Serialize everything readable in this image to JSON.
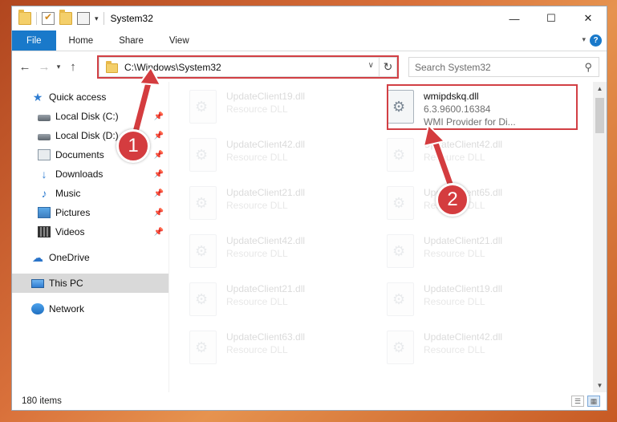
{
  "titlebar": {
    "title": "System32",
    "minimize": "—",
    "maximize": "☐",
    "close": "✕"
  },
  "ribbon": {
    "tabs": [
      "File",
      "Home",
      "Share",
      "View"
    ],
    "help": "?"
  },
  "address": {
    "path": "C:\\Windows\\System32",
    "search_placeholder": "Search System32"
  },
  "nav": {
    "items": [
      {
        "label": "Quick access",
        "icon": "star-icon",
        "pinned": false
      },
      {
        "label": "Local Disk (C:)",
        "icon": "disk-icon",
        "pinned": true
      },
      {
        "label": "Local Disk (D:)",
        "icon": "disk-icon",
        "pinned": true
      },
      {
        "label": "Documents",
        "icon": "documents-icon",
        "pinned": true
      },
      {
        "label": "Downloads",
        "icon": "download-icon",
        "pinned": true
      },
      {
        "label": "Music",
        "icon": "music-icon",
        "pinned": true
      },
      {
        "label": "Pictures",
        "icon": "pictures-icon",
        "pinned": true
      },
      {
        "label": "Videos",
        "icon": "videos-icon",
        "pinned": true
      },
      {
        "label": "OneDrive",
        "icon": "onedrive-icon"
      },
      {
        "label": "This PC",
        "icon": "computer-icon",
        "selected": true
      },
      {
        "label": "Network",
        "icon": "network-icon"
      }
    ]
  },
  "files": [
    {
      "name": "UpdateClient19.dll",
      "type": "Resource DLL",
      "faded": true
    },
    {
      "name": "wmipdskq.dll",
      "type": "6.3.9600.16384",
      "extra": "WMI Provider for Di...",
      "faded": false
    },
    {
      "name": "UpdateClient42.dll",
      "type": "Resource DLL",
      "faded": true
    },
    {
      "name": "UpdateClient42.dll",
      "type": "Resource DLL",
      "faded": true
    },
    {
      "name": "UpdateClient21.dll",
      "type": "Resource DLL",
      "faded": true
    },
    {
      "name": "UpdateClient65.dll",
      "type": "Resource DLL",
      "faded": true
    },
    {
      "name": "UpdateClient42.dll",
      "type": "Resource DLL",
      "faded": true
    },
    {
      "name": "UpdateClient21.dll",
      "type": "Resource DLL",
      "faded": true
    },
    {
      "name": "UpdateClient21.dll",
      "type": "Resource DLL",
      "faded": true
    },
    {
      "name": "UpdateClient19.dll",
      "type": "Resource DLL",
      "faded": true
    },
    {
      "name": "UpdateClient63.dll",
      "type": "Resource DLL",
      "faded": true
    },
    {
      "name": "UpdateClient42.dll",
      "type": "Resource DLL",
      "faded": true
    }
  ],
  "status": {
    "count": "180 items"
  },
  "annotations": {
    "marker1": "1",
    "marker2": "2",
    "highlight_color": "#d23f44"
  }
}
